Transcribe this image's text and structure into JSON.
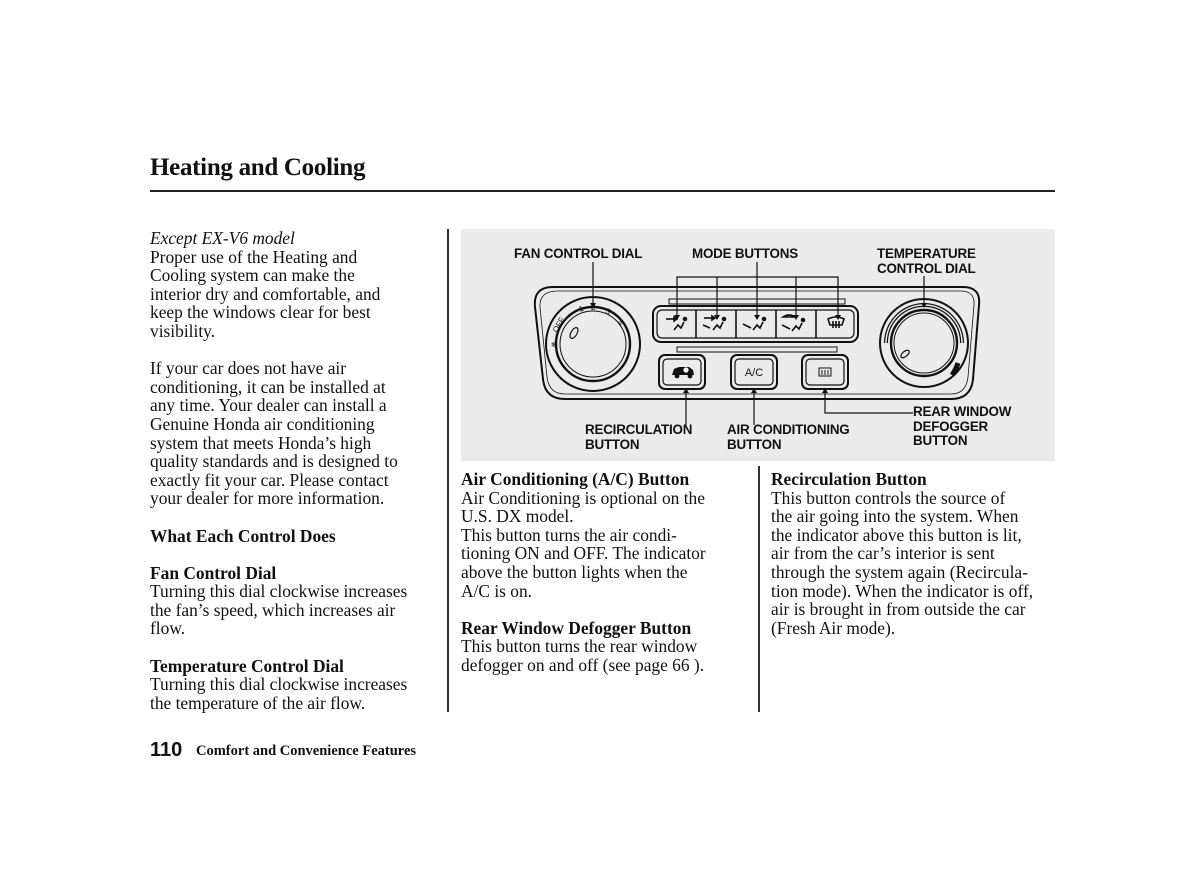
{
  "page": {
    "title": "Heating and Cooling",
    "page_number": "110",
    "section_footer": "Comfort and Convenience Features"
  },
  "left_column": {
    "model_note": "Except EX-V6 model",
    "intro_lines": [
      "Proper use of the Heating and",
      "Cooling system can make the",
      "interior dry and comfortable, and",
      "keep the windows clear for best",
      "visibility."
    ],
    "ac_install_lines": [
      "If your car does not have air",
      "conditioning, it can be installed at",
      "any time. Your dealer can install a",
      "Genuine Honda air conditioning",
      "system that meets Honda’s high",
      "quality standards and is designed to",
      "exactly fit your car. Please contact",
      "your dealer for more information."
    ],
    "what_each_heading": "What Each Control Does",
    "fan_dial": {
      "heading": "Fan Control Dial",
      "lines": [
        "Turning this dial clockwise increases",
        "the fan’s speed, which increases air",
        "flow."
      ]
    },
    "temp_dial": {
      "heading": "Temperature Control Dial",
      "lines": [
        "Turning this dial clockwise increases",
        "the temperature of the air flow."
      ]
    }
  },
  "middle_column": {
    "ac_button": {
      "heading": "Air Conditioning (A/C) Button",
      "lines": [
        "Air Conditioning is optional on the",
        "U.S. DX model.",
        "This button turns the air condi-",
        "tioning ON and OFF. The indicator",
        "above the button lights when the",
        "A/C is on."
      ]
    },
    "defogger_button": {
      "heading": "Rear Window Defogger Button",
      "lines": [
        "This button turns the rear window",
        "defogger on and off (see page  66  )."
      ]
    }
  },
  "right_column": {
    "recirc_button": {
      "heading": "Recirculation Button",
      "lines": [
        "This button controls the source of",
        "the air going into the system. When",
        "the indicator above this button is lit,",
        "air from the car’s interior is sent",
        "through the system again (Recircula-",
        "tion mode). When the indicator is off,",
        "air is brought in from outside the car",
        "(Fresh Air mode)."
      ]
    }
  },
  "figure": {
    "labels": {
      "fan_control_dial": "FAN CONTROL DIAL",
      "mode_buttons": "MODE BUTTONS",
      "temp_dial_line1": "TEMPERATURE",
      "temp_dial_line2": "CONTROL DIAL",
      "recirc_line1": "RECIRCULATION",
      "recirc_line2": "BUTTON",
      "ac_line1": "AIR CONDITIONING",
      "ac_line2": "BUTTON",
      "defog_line1": "REAR WINDOW",
      "defog_line2": "DEFOGGER",
      "defog_line3": "BUTTON"
    },
    "fan_dial_marks": [
      "OFF",
      "1",
      "2",
      "3",
      "4"
    ],
    "ac_button_text": "A/C",
    "mode_icons": [
      "vent-mode-icon",
      "bi-level-mode-icon",
      "floor-mode-icon",
      "floor-defrost-mode-icon",
      "defrost-mode-icon"
    ],
    "colors": {
      "figure_bg": "#ebebeb",
      "ink": "#111111"
    }
  }
}
